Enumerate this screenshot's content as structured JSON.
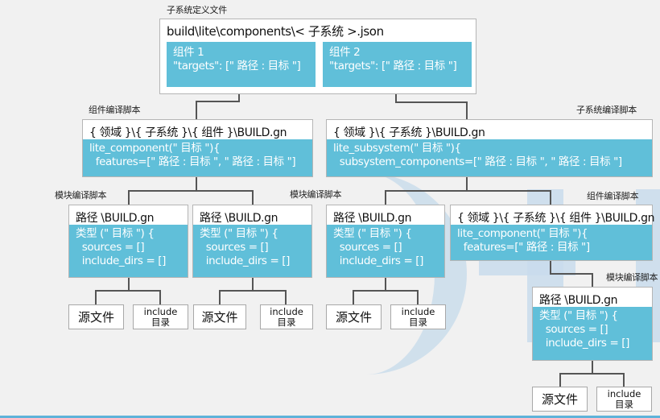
{
  "labels": {
    "subsystem_def_file": "子系统定义文件",
    "component_script_left": "组件编译脚本",
    "subsystem_script": "子系统编译脚本",
    "module_script_1": "模块编译脚本",
    "module_script_2": "模块编译脚本",
    "component_script_right": "组件编译脚本",
    "module_script_3": "模块编译脚本"
  },
  "root": {
    "path": "build\\lite\\components\\< 子系统 >.json",
    "component1": "组件 1\n\"targets\": [\" 路径 : 目标 \"]",
    "component2": "组件 2\n\"targets\": [\" 路径 : 目标 \"]"
  },
  "component_build": {
    "path": "{ 领域 }\\{ 子系统 }\\{ 组件 }\\BUILD.gn",
    "code": "lite_component(\" 目标 \"){\n  features=[\" 路径 : 目标 \", \" 路径 : 目标 \"]"
  },
  "subsystem_build": {
    "path": "{ 领域 }\\{ 子系统 }\\BUILD.gn",
    "code": "lite_subsystem(\" 目标 \"){\n  subsystem_components=[\" 路径 : 目标 \", \" 路径 : 目标 \"]"
  },
  "component_build_2": {
    "path": "{ 领域 }\\{ 子系统 }\\{ 组件 }\\BUILD.gn",
    "code": "lite_component(\" 目标 \"){\n  features=[\" 路径 : 目标 \"]"
  },
  "module_build": {
    "path": "路径 \\BUILD.gn",
    "code": "类型 (\" 目标 \") {\n  sources = []\n  include_dirs = []"
  },
  "leaves": {
    "source_files": "源文件",
    "include_line1": "include",
    "include_line2": "目录"
  },
  "colors": {
    "accent_block": "#60bfd9",
    "background": "#f1f1f1",
    "watermark": "#c9dcec"
  }
}
